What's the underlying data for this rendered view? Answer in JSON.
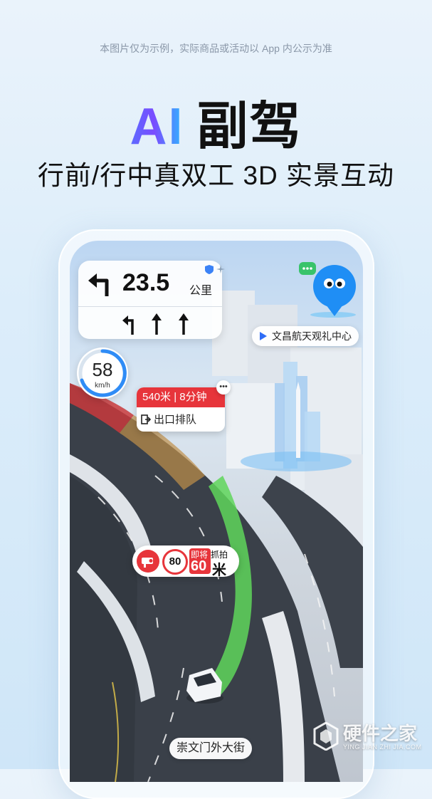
{
  "disclaimer": "本图片仅为示例，实际商品或活动以 App 内公示为准",
  "headline": {
    "ai": "AI",
    "rest": "副驾"
  },
  "subline": "行前/行中真双工 3D 实景互动",
  "nav": {
    "distance": "23.5",
    "unit": "公里",
    "turn_icon": "turn-left-icon",
    "lanes": [
      "turn-left-icon",
      "straight-arrow-icon",
      "straight-arrow-icon"
    ]
  },
  "speed": {
    "value": "58",
    "unit": "km/h"
  },
  "exit_card": {
    "distance_time": "540米 | 8分钟",
    "label": "出口排队"
  },
  "poi": {
    "label": "文昌航天观礼中心"
  },
  "camera": {
    "limit": "80",
    "soon": "即将",
    "capture": "抓拍",
    "distance_num": "60",
    "distance_unit": "米"
  },
  "street": "崇文门外大街",
  "watermark": {
    "title": "硬件之家",
    "sub": "YING JIAN ZHI JIA.COM"
  },
  "colors": {
    "accent_red": "#e7353b",
    "green_lane": "#5fd65a",
    "ai_gradient": "#5b6cff"
  }
}
